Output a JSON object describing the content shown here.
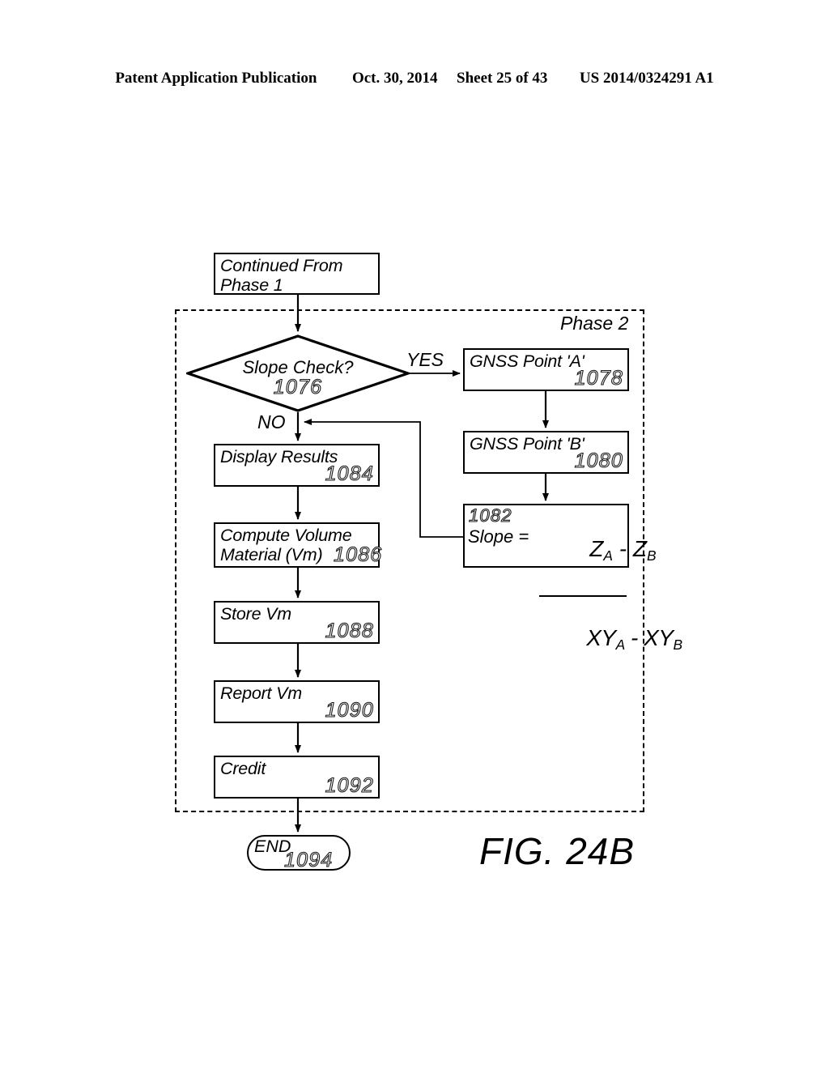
{
  "header": {
    "publication": "Patent Application Publication",
    "date": "Oct. 30, 2014",
    "sheet": "Sheet 25 of 43",
    "patent_number": "US 2014/0324291 A1"
  },
  "figure": {
    "caption": "FIG. 24B",
    "phase_label": "Phase 2"
  },
  "nodes": {
    "continued": {
      "line1": "Continued From",
      "line2": "Phase 1"
    },
    "slope_check": {
      "label": "Slope Check?",
      "ref": "1076"
    },
    "gnss_a": {
      "label": "GNSS Point 'A'",
      "ref": "1078"
    },
    "gnss_b": {
      "label": "GNSS Point 'B'",
      "ref": "1080"
    },
    "slope_formula": {
      "ref": "1082",
      "lhs": "Slope =",
      "numerator_z_a": "Z",
      "numerator_sub_a": "A",
      "numerator_minus": " - ",
      "numerator_z_b": "Z",
      "numerator_sub_b": "B",
      "denominator_xy_a": "XY",
      "denominator_sub_a": "A",
      "denominator_minus": " - ",
      "denominator_xy_b": "XY",
      "denominator_sub_b": "B"
    },
    "display_results": {
      "label": "Display Results",
      "ref": "1084"
    },
    "compute_volume": {
      "line1": "Compute Volume",
      "line2": "Material (Vm)",
      "ref": "1086"
    },
    "store_vm": {
      "label": "Store Vm",
      "ref": "1088"
    },
    "report_vm": {
      "label": "Report Vm",
      "ref": "1090"
    },
    "credit": {
      "label": "Credit",
      "ref": "1092"
    },
    "end": {
      "label": "END",
      "ref": "1094"
    }
  },
  "edges": {
    "yes_label": "YES",
    "no_label": "NO"
  },
  "colors": {
    "ink": "#000000",
    "paper": "#ffffff"
  }
}
